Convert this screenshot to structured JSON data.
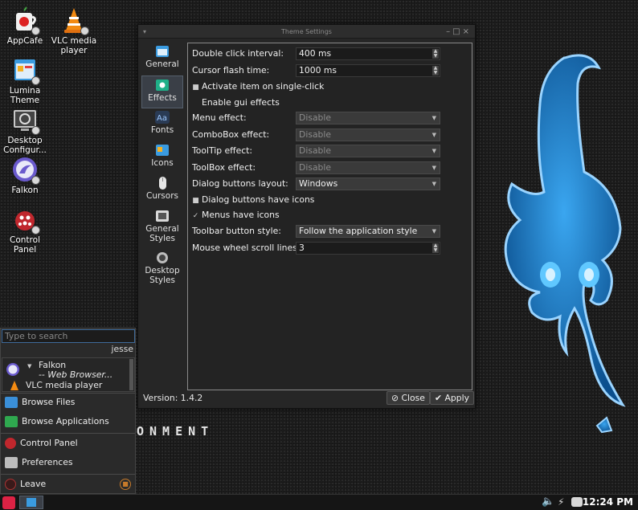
{
  "desktop": {
    "icons": [
      {
        "label": "AppCafe"
      },
      {
        "label": "VLC media player"
      },
      {
        "label": "Lumina Theme"
      },
      {
        "label": "Desktop Configur..."
      },
      {
        "label": "Falkon"
      },
      {
        "label": "Control Panel"
      }
    ],
    "watermark": "ONMENT"
  },
  "window": {
    "title": "Theme Settings",
    "sidebar": [
      {
        "label": "General"
      },
      {
        "label": "Effects"
      },
      {
        "label": "Fonts"
      },
      {
        "label": "Icons"
      },
      {
        "label": "Cursors"
      },
      {
        "label": "General Styles"
      },
      {
        "label": "Desktop Styles"
      }
    ],
    "settings": {
      "double_click_label": "Double click interval:",
      "double_click_value": "400 ms",
      "cursor_flash_label": "Cursor flash time:",
      "cursor_flash_value": "1000 ms",
      "single_click_label": "Activate item on single-click",
      "gui_effects_label": "Enable gui effects",
      "menu_effect_label": "Menu effect:",
      "menu_effect_value": "Disable",
      "combobox_effect_label": "ComboBox effect:",
      "combobox_effect_value": "Disable",
      "tooltip_effect_label": "ToolTip effect:",
      "tooltip_effect_value": "Disable",
      "toolbox_effect_label": "ToolBox effect:",
      "toolbox_effect_value": "Disable",
      "dialog_layout_label": "Dialog buttons layout:",
      "dialog_layout_value": "Windows",
      "dialog_icons_label": "Dialog buttons have icons",
      "menus_icons_label": "Menus have icons",
      "menus_icons_mark": "✓",
      "toolbar_style_label": "Toolbar button style:",
      "toolbar_style_value": "Follow the application style",
      "wheel_lines_label": "Mouse wheel scroll lines:",
      "wheel_lines_value": "3"
    },
    "version": "Version: 1.4.2",
    "close_label": "Close",
    "apply_label": "Apply"
  },
  "start_menu": {
    "search_placeholder": "Type to search",
    "user": "jesse",
    "recent": [
      {
        "name": "Falkon",
        "desc": "-- Web Browser..."
      },
      {
        "name": "VLC media player"
      }
    ],
    "browse_files": "Browse Files",
    "browse_apps": "Browse Applications",
    "control_panel": "Control Panel",
    "preferences": "Preferences",
    "leave": "Leave"
  },
  "taskbar": {
    "clock": "12:24 PM"
  },
  "colors": {
    "accent": "#2f8fe0",
    "mascot": "#1f7fd0"
  }
}
